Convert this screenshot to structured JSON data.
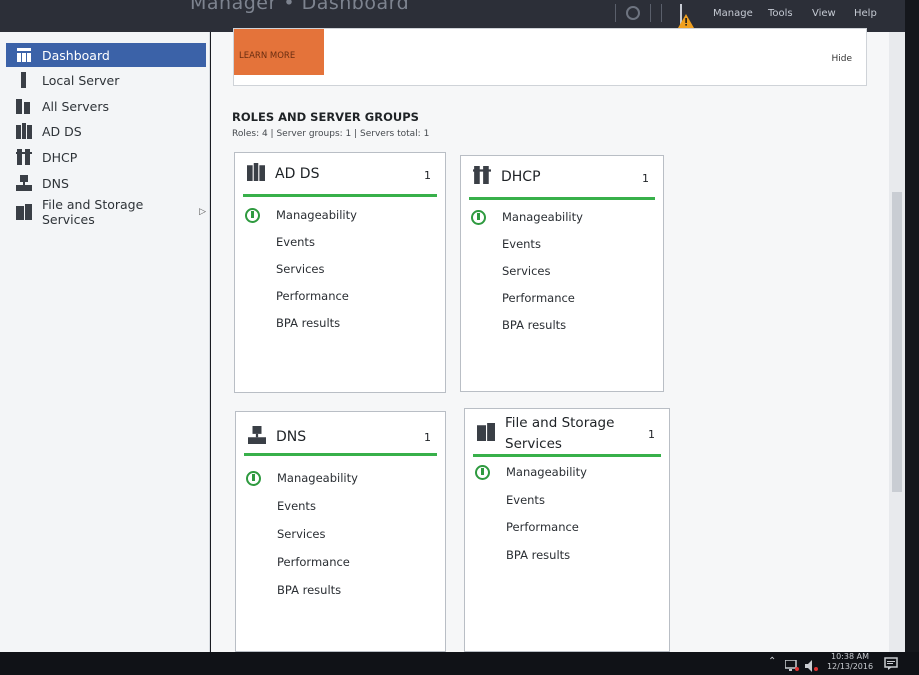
{
  "titlebar": {
    "app_title": "Manager • Dashboard",
    "menu": [
      "Manage",
      "Tools",
      "View",
      "Help"
    ]
  },
  "sidebar": {
    "items": [
      {
        "label": "Dashboard",
        "icon": "dashboard-icon",
        "active": true
      },
      {
        "label": "Local Server",
        "icon": "server-icon"
      },
      {
        "label": "All Servers",
        "icon": "servers-icon"
      },
      {
        "label": "AD DS",
        "icon": "ad-ds-icon"
      },
      {
        "label": "DHCP",
        "icon": "dhcp-icon"
      },
      {
        "label": "DNS",
        "icon": "dns-icon"
      },
      {
        "label": "File and Storage Services",
        "icon": "file-storage-icon",
        "has_submenu": true
      }
    ]
  },
  "banner": {
    "learn_more": "LEARN MORE",
    "hide": "Hide"
  },
  "roles": {
    "title": "ROLES AND SERVER GROUPS",
    "summary": "Roles: 4  |  Server groups: 1  |  Servers total: 1",
    "tiles": [
      {
        "name": "AD DS",
        "count": "1",
        "rows": [
          "Manageability",
          "Events",
          "Services",
          "Performance",
          "BPA results"
        ]
      },
      {
        "name": "DHCP",
        "count": "1",
        "rows": [
          "Manageability",
          "Events",
          "Services",
          "Performance",
          "BPA results"
        ]
      },
      {
        "name": "DNS",
        "count": "1",
        "rows": [
          "Manageability",
          "Events",
          "Services",
          "Performance",
          "BPA results"
        ]
      },
      {
        "name": "File and Storage Services",
        "count": "1",
        "rows": [
          "Manageability",
          "Events",
          "Performance",
          "BPA results"
        ]
      }
    ],
    "status_color": "#38b04a"
  },
  "taskbar": {
    "time": "10:38 AM",
    "date": "12/13/2016"
  }
}
